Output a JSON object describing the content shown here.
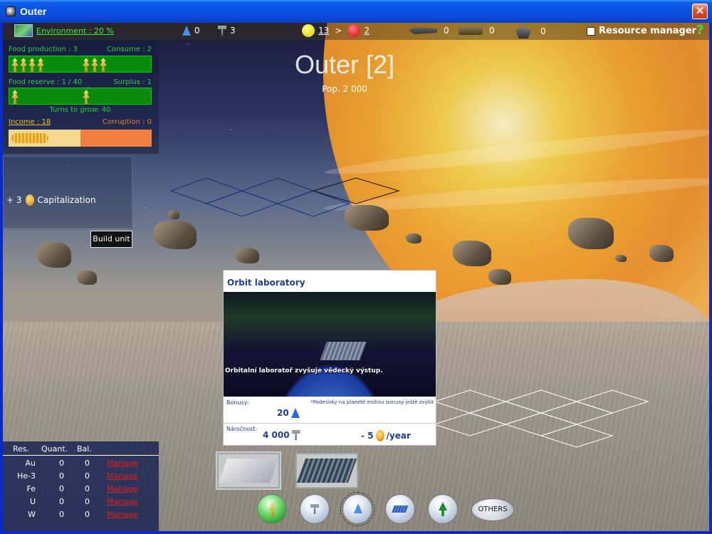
{
  "window": {
    "title": "Outer",
    "close_label": "✕"
  },
  "topbar": {
    "environment": "Environment : 20 %",
    "science": "0",
    "production": "3",
    "happy": "13",
    "compare": ">",
    "unhappy": "2",
    "units": [
      "0",
      "0",
      "0"
    ],
    "resource_manager": "Resource manager",
    "help": "?"
  },
  "food": {
    "production_label": "Food production : 3",
    "consume_label": "Consume : 2",
    "reserve_label": "Food reserve : 1 / 40",
    "surplus_label": "Surplus : 1",
    "turns_label": "Turns to grow: 40",
    "income_label": "Income : 18",
    "corruption_label": "Corruption : 0",
    "income_fill": 0.5
  },
  "bonus": {
    "value": "+ 3",
    "label": "Capitalization"
  },
  "build_unit": "Build unit",
  "planet": {
    "name": "Outer [2]",
    "pop": "Pop.  2 000"
  },
  "popup": {
    "title": "Orbit laboratory",
    "description": "Orbitalní laboratoř zvyšuje vědecký výstup.",
    "bonus_label": "Bonusy:",
    "condition_note": "*Podmínky na planetě mohou bonusy ještě zvýšit",
    "bonus_value": "20",
    "cost_label": "Náročnost:",
    "cost_value": "4 000",
    "upkeep_value": "- 5",
    "upkeep_unit": "/year"
  },
  "categories": {
    "others": "OTHERS"
  },
  "resources": {
    "headers": [
      "Res.",
      "Quant.",
      "Bal."
    ],
    "manage_label": "Manage",
    "rows": [
      {
        "res": "Au",
        "quant": "0",
        "bal": "0"
      },
      {
        "res": "He-3",
        "quant": "0",
        "bal": "0"
      },
      {
        "res": "Fe",
        "quant": "0",
        "bal": "0"
      },
      {
        "res": "U",
        "quant": "0",
        "bal": "0"
      },
      {
        "res": "W",
        "quant": "0",
        "bal": "0"
      }
    ]
  }
}
